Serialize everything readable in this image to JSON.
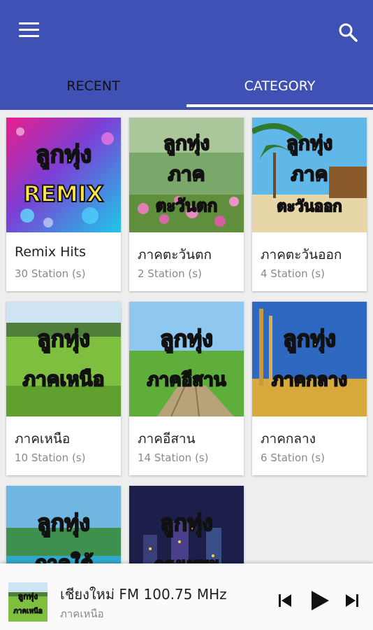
{
  "appbar": {
    "color": "#3f51b5",
    "menu_icon": "hamburger-menu-icon",
    "search_icon": "search-icon"
  },
  "tabs": [
    {
      "label": "RECENT",
      "selected": false
    },
    {
      "label": "CATEGORY",
      "selected": true
    }
  ],
  "categories": [
    {
      "name": "Remix Hits",
      "count": "30 Station (s)",
      "art_line1": "ลูกทุ่ง",
      "art_line2": "REMIX",
      "art_line3": ""
    },
    {
      "name": "ภาคตะวันตก",
      "count": "2 Station (s)",
      "art_line1": "ลูกทุ่ง",
      "art_line2": "ภาค",
      "art_line3": "ตะวันตก"
    },
    {
      "name": "ภาคตะวันออก",
      "count": "4 Station (s)",
      "art_line1": "ลูกทุ่ง",
      "art_line2": "ภาค",
      "art_line3": "ตะวันออก"
    },
    {
      "name": "ภาคเหนือ",
      "count": "10 Station (s)",
      "art_line1": "ลูกทุ่ง",
      "art_line2": "ภาคเหนือ",
      "art_line3": ""
    },
    {
      "name": "ภาคอีสาน",
      "count": "14 Station (s)",
      "art_line1": "ลูกทุ่ง",
      "art_line2": "ภาคอีสาน",
      "art_line3": ""
    },
    {
      "name": "ภาคกลาง",
      "count": "6 Station (s)",
      "art_line1": "ลูกทุ่ง",
      "art_line2": "ภาคกลาง",
      "art_line3": ""
    },
    {
      "name": "",
      "count": "",
      "art_line1": "ลูกทุ่ง",
      "art_line2": "ภาคใต้",
      "art_line3": ""
    },
    {
      "name": "",
      "count": "",
      "art_line1": "ลูกทุ่ง",
      "art_line2": "กรุงเทพฯ",
      "art_line3": ""
    }
  ],
  "player": {
    "title": "เชียงใหม่ FM 100.75 MHz",
    "subtitle": "ภาคเหนือ",
    "thumb_line1": "ลูกทุ่ง",
    "thumb_line2": "ภาคเหนือ",
    "controls": [
      "skip-previous-icon",
      "play-icon",
      "skip-next-icon"
    ]
  }
}
